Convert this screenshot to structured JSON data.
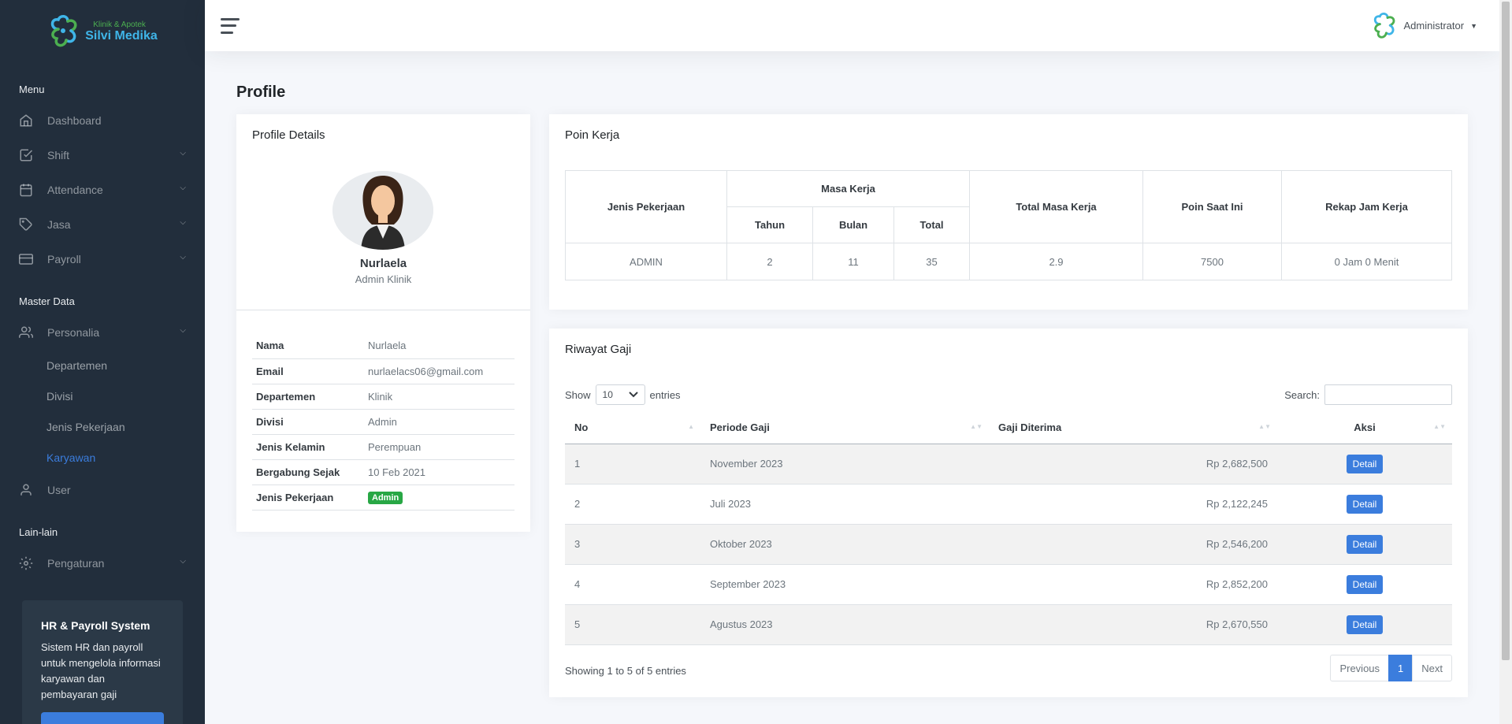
{
  "brand": {
    "small": "Klinik & Apotek",
    "name": "Silvi Medika"
  },
  "sidebar": {
    "menu_header": "Menu",
    "menu": [
      {
        "label": "Dashboard",
        "icon": "home-icon"
      },
      {
        "label": "Shift",
        "icon": "check-square-icon"
      },
      {
        "label": "Attendance",
        "icon": "calendar-icon"
      },
      {
        "label": "Jasa",
        "icon": "tag-icon"
      },
      {
        "label": "Payroll",
        "icon": "credit-card-icon"
      }
    ],
    "master_header": "Master Data",
    "personalia": {
      "label": "Personalia",
      "icon": "users-icon"
    },
    "sub_items": [
      "Departemen",
      "Divisi",
      "Jenis Pekerjaan",
      "Karyawan"
    ],
    "active_sub": "Karyawan",
    "user": {
      "label": "User",
      "icon": "user-icon"
    },
    "lain_header": "Lain-lain",
    "pengaturan": {
      "label": "Pengaturan",
      "icon": "gear-icon"
    },
    "cta": {
      "title": "HR & Payroll System",
      "text": "Sistem HR dan payroll untuk mengelola informasi karyawan dan pembayaran gaji"
    }
  },
  "topbar": {
    "user_name": "Administrator"
  },
  "page": {
    "title": "Profile"
  },
  "profile": {
    "card_title": "Profile Details",
    "name": "Nurlaela",
    "role": "Admin Klinik",
    "fields": [
      {
        "key": "Nama",
        "value": "Nurlaela"
      },
      {
        "key": "Email",
        "value": "nurlaelacs06@gmail.com"
      },
      {
        "key": "Departemen",
        "value": "Klinik"
      },
      {
        "key": "Divisi",
        "value": "Admin"
      },
      {
        "key": "Jenis Kelamin",
        "value": "Perempuan"
      },
      {
        "key": "Bergabung Sejak",
        "value": "10 Feb 2021"
      },
      {
        "key": "Jenis Pekerjaan",
        "value": "Admin"
      }
    ]
  },
  "poin": {
    "card_title": "Poin Kerja",
    "headers": {
      "jenis": "Jenis Pekerjaan",
      "masa": "Masa Kerja",
      "tahun": "Tahun",
      "bulan": "Bulan",
      "total": "Total",
      "total_masa": "Total Masa Kerja",
      "poin": "Poin Saat Ini",
      "rekap": "Rekap Jam Kerja"
    },
    "row": {
      "jenis": "ADMIN",
      "tahun": "2",
      "bulan": "11",
      "total": "35",
      "total_masa": "2.9",
      "poin": "7500",
      "rekap": "0 Jam 0 Menit"
    }
  },
  "gaji": {
    "card_title": "Riwayat Gaji",
    "show_label": "Show",
    "entries_value": "10",
    "entries_label": "entries",
    "search_label": "Search:",
    "search_value": "",
    "columns": [
      "No",
      "Periode Gaji",
      "Gaji Diterima",
      "Aksi"
    ],
    "rows": [
      {
        "no": "1",
        "periode": "November 2023",
        "gaji": "Rp 2,682,500",
        "aksi": "Detail"
      },
      {
        "no": "2",
        "periode": "Juli 2023",
        "gaji": "Rp 2,122,245",
        "aksi": "Detail"
      },
      {
        "no": "3",
        "periode": "Oktober 2023",
        "gaji": "Rp 2,546,200",
        "aksi": "Detail"
      },
      {
        "no": "4",
        "periode": "September 2023",
        "gaji": "Rp 2,852,200",
        "aksi": "Detail"
      },
      {
        "no": "5",
        "periode": "Agustus 2023",
        "gaji": "Rp 2,670,550",
        "aksi": "Detail"
      }
    ],
    "showing": "Showing 1 to 5 of 5 entries",
    "pager": {
      "previous": "Previous",
      "current": "1",
      "next": "Next"
    }
  },
  "colors": {
    "sidebar": "#222e3c",
    "primary": "#3b7ddd",
    "badge": "#28a745"
  }
}
